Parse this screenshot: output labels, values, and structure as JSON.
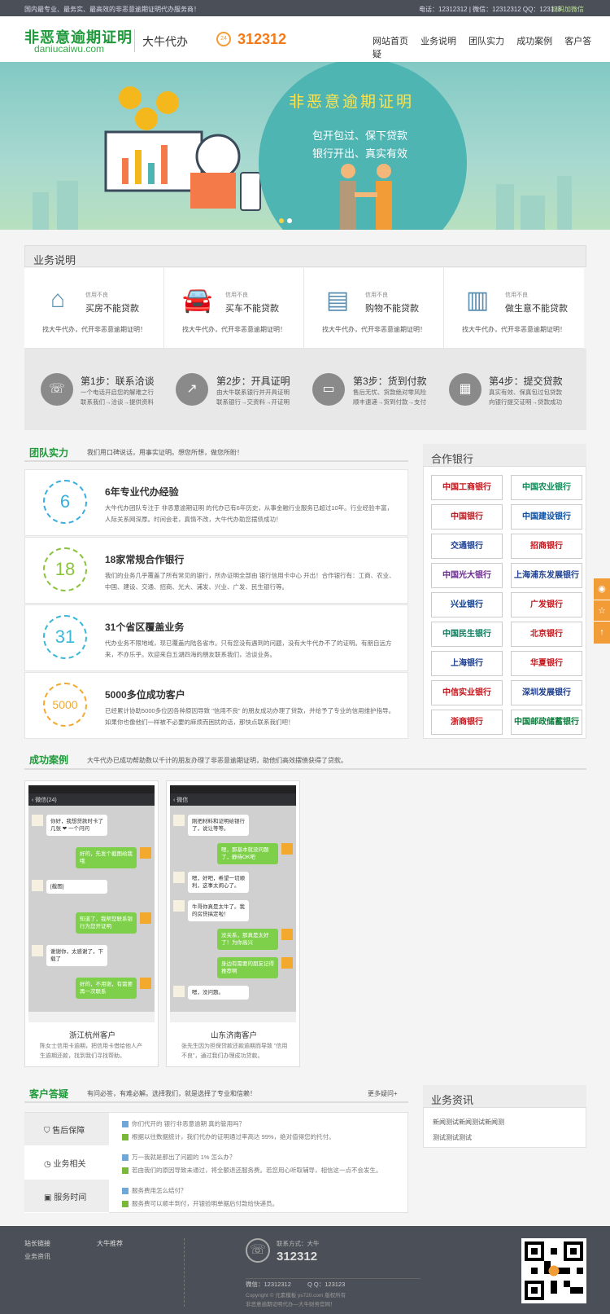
{
  "topbar": {
    "left": "国内最专业、最务实、最高效的非恶意逾期证明代办服务商！",
    "right": "电话：12312312 | 微信：12312312    QQ：123123",
    "wechat": "扫码加微信"
  },
  "header": {
    "logo_cn": "非恶意逾期证明",
    "logo_en": "daniucaiwu.com",
    "slogan": "大牛代办",
    "tel": "312312",
    "nav": [
      "网站首页",
      "业务说明",
      "团队实力",
      "成功案例",
      "客户答疑"
    ]
  },
  "banner": {
    "title": "非恶意逾期证明",
    "line1": "包开包过、保下贷款",
    "line2": "银行开出、真实有效"
  },
  "services": {
    "title": "业务说明",
    "cards": [
      {
        "small": "信用不良",
        "title": "买房不能贷款",
        "desc": "找大牛代办，代开非恶意逾期证明！",
        "icon": "house-icon"
      },
      {
        "small": "信用不良",
        "title": "买车不能贷款",
        "desc": "找大牛代办，代开非恶意逾期证明！",
        "icon": "car-icon"
      },
      {
        "small": "信用不良",
        "title": "购物不能贷款",
        "desc": "找大牛代办，代开非恶意逾期证明！",
        "icon": "card-icon"
      },
      {
        "small": "信用不良",
        "title": "做生意不能贷款",
        "desc": "找大牛代办，代开非恶意逾期证明！",
        "icon": "bank-icon"
      }
    ],
    "steps": [
      {
        "title": "第1步：联系洽谈",
        "desc1": "一个电话开启您的解难之行",
        "desc2": "联系我们→洽谈→提供资料",
        "icon": "phone-icon"
      },
      {
        "title": "第2步：开具证明",
        "desc1": "由大牛联系银行并开具证明",
        "desc2": "联系银行→交资料→开证明",
        "icon": "chart-icon"
      },
      {
        "title": "第3步：货到付款",
        "desc1": "售后无忧、货款绝对零风险",
        "desc2": "顺丰速递→货到付款→支付",
        "icon": "money-icon"
      },
      {
        "title": "第4步：提交贷款",
        "desc1": "真实有效、保真包过包贷款",
        "desc2": "向银行提交证明→贷款成功",
        "icon": "calculator-icon"
      }
    ]
  },
  "team": {
    "title": "团队实力",
    "subtitle": "我们用口碑说话，用事实证明。想您所想，做您所盼！",
    "items": [
      {
        "num": "6",
        "title": "6年专业代办经验",
        "desc": "大牛代办团队专注于 非恶意逾期证明 的代办已有6年历史，从事金融行业服务已超过10年。行业经验丰富，人际关系网深厚。时间会老，真情不改，大牛代办助您摆债成功！",
        "color": "#3aaee0"
      },
      {
        "num": "18",
        "title": "18家常规合作银行",
        "desc": "我们的业务几乎覆盖了所有常见的银行，所办证明全部由 银行信用卡中心 开出！合作银行有：工商、农业、中国、建设、交通、招商、光大、浦发、兴业、广发、民生银行等。",
        "color": "#8ac43c"
      },
      {
        "num": "31",
        "title": "31个省区覆盖业务",
        "desc": "代办业务不限地域，现已覆盖内陆各省市。只有您没有遇到的问题，没有大牛代办不了的证明。有朋自远方来，不亦乐乎。欢迎来自五湖四海的朋友联系我们，洽谈业务。",
        "color": "#3ab8d8"
      },
      {
        "num": "5000",
        "title": "5000多位成功客户",
        "desc": "已经累计协助5000多位因各种原因导致 \"信用不良\" 的朋友成功办理了贷款，并给予了专业的信用维护指导。如果你也像他们一样被不必要的麻烦而困扰的话，那快点联系我们吧！",
        "color": "#f2a92e"
      }
    ]
  },
  "banks": {
    "title": "合作银行",
    "items": [
      {
        "name": "中国工商银行",
        "color": "#c4161c"
      },
      {
        "name": "中国农业银行",
        "color": "#0a8a55"
      },
      {
        "name": "中国银行",
        "color": "#b81c22"
      },
      {
        "name": "中国建设银行",
        "color": "#0a4ea2"
      },
      {
        "name": "交通银行",
        "color": "#1d3f8e"
      },
      {
        "name": "招商银行",
        "color": "#c4161c"
      },
      {
        "name": "中国光大银行",
        "color": "#6a2c8e"
      },
      {
        "name": "上海浦东发展银行",
        "color": "#1d3f8e"
      },
      {
        "name": "兴业银行",
        "color": "#0a3a8a"
      },
      {
        "name": "广发银行",
        "color": "#c4161c"
      },
      {
        "name": "中国民生银行",
        "color": "#0a7a5a"
      },
      {
        "name": "北京银行",
        "color": "#c4161c"
      },
      {
        "name": "上海银行",
        "color": "#1a3a8a"
      },
      {
        "name": "华夏银行",
        "color": "#c4161c"
      },
      {
        "name": "中信实业银行",
        "color": "#c4161c"
      },
      {
        "name": "深圳发展银行",
        "color": "#1a3a8a"
      },
      {
        "name": "浙商银行",
        "color": "#c4161c"
      },
      {
        "name": "中国邮政储蓄银行",
        "color": "#0a7a3a"
      }
    ]
  },
  "cases": {
    "title": "成功案例",
    "subtitle": "大牛代办已成功帮助数以千计的朋友办理了非恶意逾期证明，助他们高效摆债获得了贷款。",
    "items": [
      {
        "name": "浙江杭州客户",
        "desc": "陈女士信用卡逾期，把信用卡借给他人产生逾期还款，找到我们寻找帮助。",
        "nav": "微信(24)",
        "msgs": [
          {
            "t": "w",
            "s": "你好，我想贷款时卡了几张 ❤ 一个问问"
          },
          {
            "t": "g",
            "s": "好的，先发个截图给我哦"
          },
          {
            "t": "w",
            "s": "[截图]"
          },
          {
            "t": "g",
            "s": "知道了，我帮您联系银行为您开证明"
          },
          {
            "t": "w",
            "s": "谢谢你，太感谢了，下载了"
          },
          {
            "t": "g",
            "s": "好的，不用谢，有需要再一次联系"
          }
        ]
      },
      {
        "name": "山东济南客户",
        "desc": "张先生因为担保贷款还款逾期而导致 \"信用不良\"，通过我们办理成功贷款。",
        "nav": "微信",
        "msgs": [
          {
            "t": "w",
            "s": "刚把材料和证明给银行了，说让等等。"
          },
          {
            "t": "g",
            "s": "嗯，那基本就没问题了，静待OK吧"
          },
          {
            "t": "w",
            "s": "嗯，好吧，希望一切顺利，这事太闹心了。"
          },
          {
            "t": "w",
            "s": "牛哥你真是太牛了。我的房贷搞定啦！"
          },
          {
            "t": "g",
            "s": "没关系，那真是太好了！为你高兴"
          },
          {
            "t": "g",
            "s": "身边有需要的朋友记得推荐啊"
          },
          {
            "t": "w",
            "s": "嗯，没问题。"
          }
        ]
      }
    ]
  },
  "faq": {
    "title": "客户答疑",
    "subtitle": "有问必答，有难必解。选择我们，就是选择了专业和信赖！",
    "more": "更多疑问+",
    "tabs": [
      "售后保障",
      "业务相关",
      "服务时间"
    ],
    "items": [
      {
        "q": "你们代开的 银行非恶意逾期 真的管用吗？",
        "a": "根据以往数据统计，我们代办的证明通过率高达 99%，绝对值得您的托付。"
      },
      {
        "q": "万一我就是那出了问题的 1% 怎么办？",
        "a": "若由我们的原因导致未通过，将全额退还服务费。若您用心听取辅导，相信这一点不会发生。"
      },
      {
        "q": "服务费用怎么结付？",
        "a": "服务费可以顺丰到付，开银验明单据后付款给快递员。"
      }
    ]
  },
  "news": {
    "title": "业务资讯",
    "items": [
      "新闻测试新闻测试新闻测",
      "测试测试测试"
    ]
  },
  "footer": {
    "links_title": "站长链接",
    "links": [
      "业务资讯"
    ],
    "rec_title": "大牛推荐",
    "contact_label": "联系方式：大牛",
    "tel": "312312",
    "wx": "微信：12312312",
    "qq": "Q Q：123123",
    "copy1": "Copyright © 元素模板 ys720.com 版权所有",
    "copy2": "非恶意逾期证明代办—大牛财务官网！"
  },
  "colors": {
    "brand": "#1f9a3a",
    "accent": "#f27a1a",
    "footer": "#4b4f57"
  }
}
